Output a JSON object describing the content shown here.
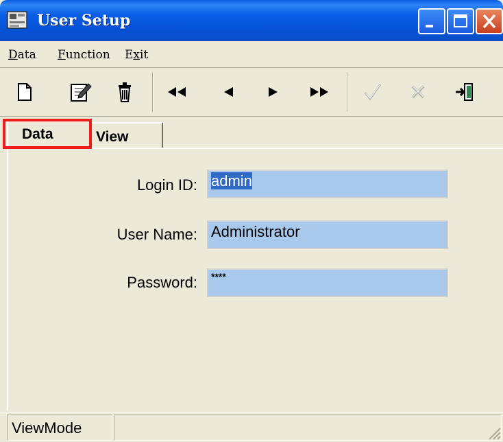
{
  "window": {
    "title": "User Setup"
  },
  "menu": {
    "items": [
      {
        "prefix": "",
        "accel": "D",
        "rest": "ata"
      },
      {
        "prefix": "",
        "accel": "F",
        "rest": "unction"
      },
      {
        "prefix": "E",
        "accel": "x",
        "rest": "it"
      }
    ]
  },
  "toolbar": {
    "buttons": [
      "new-icon",
      "edit-icon",
      "delete-icon",
      "first-record-icon",
      "previous-record-icon",
      "next-record-icon",
      "last-record-icon",
      "confirm-icon",
      "cancel-icon",
      "exit-icon"
    ]
  },
  "tabs": {
    "data_label": "Data",
    "view_label": "View"
  },
  "form": {
    "login_label": "Login ID:",
    "login_value": "admin",
    "username_label": "User Name:",
    "username_value": "Administrator",
    "password_label": "Password:",
    "password_value": "****"
  },
  "statusbar": {
    "mode": "ViewMode"
  },
  "colors": {
    "title_blue": "#0552d6",
    "field_bg": "#a8c8ec",
    "selection": "#316ac5",
    "highlight_box": "#ee1c1c"
  }
}
